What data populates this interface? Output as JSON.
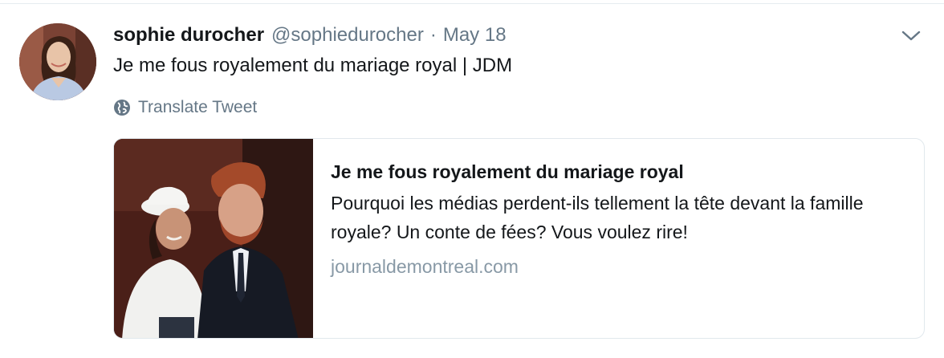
{
  "tweet": {
    "fullname": "sophie durocher",
    "screenname": "@sophiedurocher",
    "separator": "·",
    "timestamp": "May 18",
    "text": "Je me fous royalement du mariage royal | JDM",
    "translate_label": "Translate Tweet",
    "avatar_icon": "user-avatar",
    "caret_icon": "chevron-down-icon",
    "translate_icon": "globe-icon"
  },
  "card": {
    "title": "Je me fous royalement du mariage royal",
    "description": "Pourquoi les médias perdent-ils tellement la tête devant la famille royale? Un conte de fées? Vous voulez rire!",
    "domain": "journaldemontreal.com",
    "image": "couple-photo"
  },
  "colors": {
    "primary_text": "#14171a",
    "secondary_text": "#657786",
    "domain_text": "#8899a6",
    "border": "#e1e8ed"
  }
}
